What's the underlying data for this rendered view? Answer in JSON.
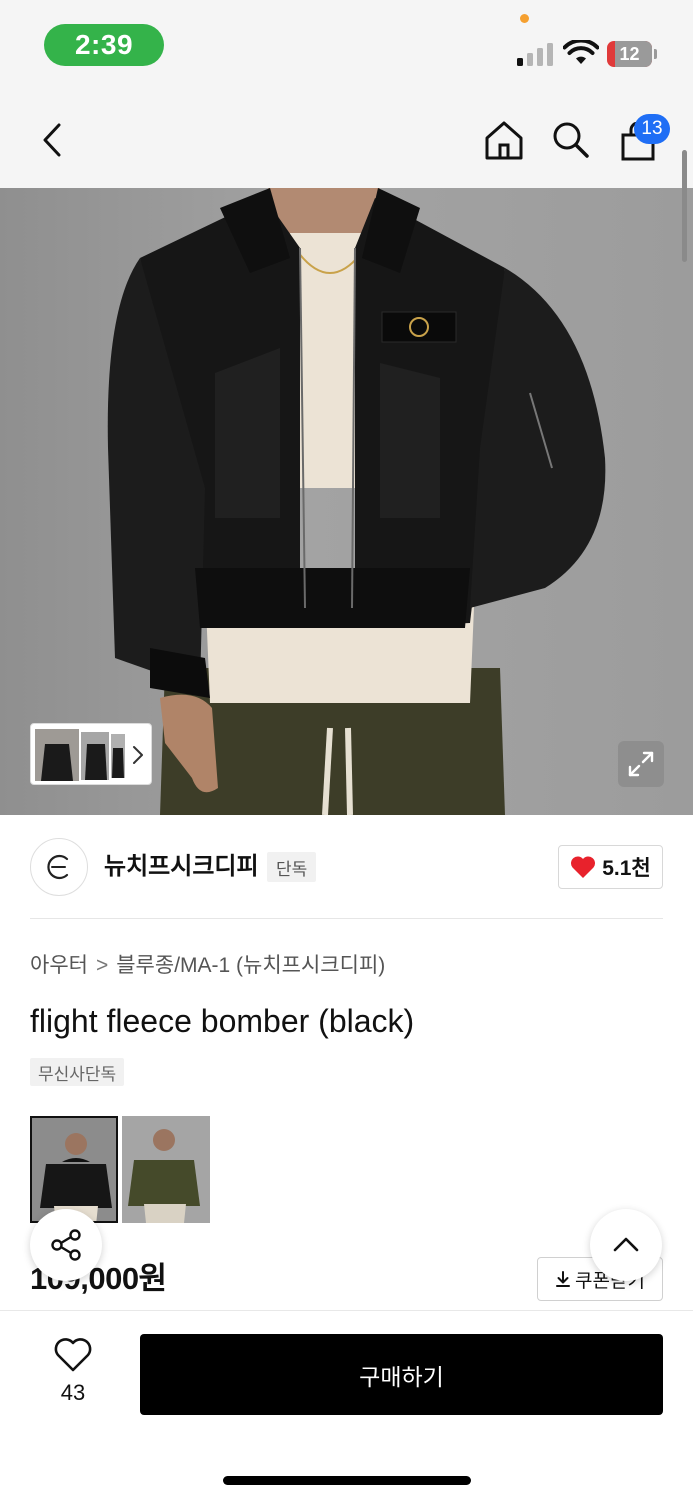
{
  "status_bar": {
    "time": "2:39",
    "battery": "12",
    "icons": [
      "signal-icon",
      "wifi-icon",
      "battery-icon"
    ]
  },
  "nav": {
    "icons": [
      "back-icon",
      "home-icon",
      "search-icon",
      "cart-icon"
    ],
    "cart_count": "13"
  },
  "brand": {
    "name": "뉴치프시크디피",
    "tag": "단독",
    "likes": "5.1천"
  },
  "product": {
    "breadcrumb": [
      "아우터",
      "블루종/MA-1 (뉴치프시크디피)"
    ],
    "title": "flight fleece bomber (black)",
    "tag": "무신사단독",
    "price": "109,000원",
    "coupon_label": "쿠폰받기"
  },
  "bottom_bar": {
    "wishlist_count": "43",
    "buy_label": "구매하기"
  },
  "colors": {
    "accent_blue": "#1f6ef5",
    "heart_red": "#e8222c",
    "status_green": "#34b34a",
    "buy_button": "#000000"
  }
}
